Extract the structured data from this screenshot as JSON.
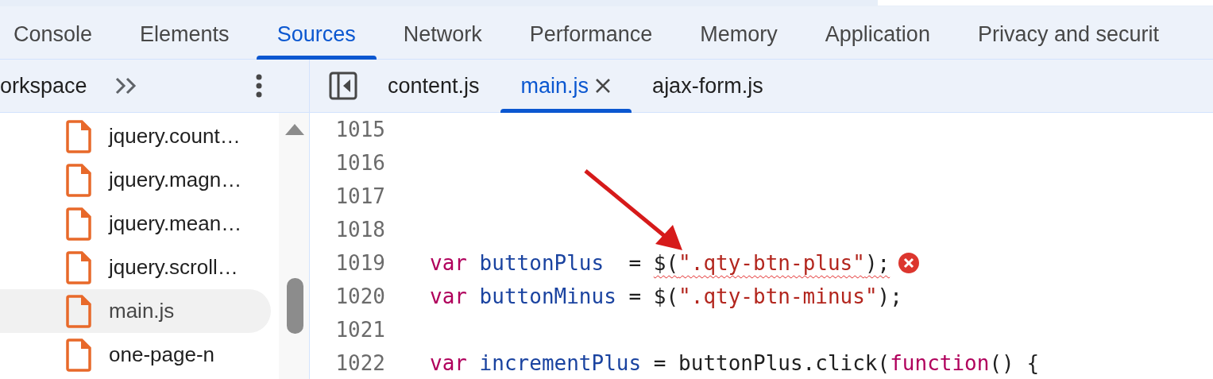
{
  "panel_tabs": [
    {
      "label": "Console",
      "selected": false
    },
    {
      "label": "Elements",
      "selected": false
    },
    {
      "label": "Sources",
      "selected": true
    },
    {
      "label": "Network",
      "selected": false
    },
    {
      "label": "Performance",
      "selected": false
    },
    {
      "label": "Memory",
      "selected": false
    },
    {
      "label": "Application",
      "selected": false
    },
    {
      "label": "Privacy and securit",
      "selected": false
    }
  ],
  "navigator": {
    "tab_label": "orkspace"
  },
  "file_tree": [
    {
      "name": "jquery.count…",
      "selected": false
    },
    {
      "name": "jquery.magn…",
      "selected": false
    },
    {
      "name": "jquery.mean…",
      "selected": false
    },
    {
      "name": "jquery.scroll…",
      "selected": false
    },
    {
      "name": "main.js",
      "selected": true
    },
    {
      "name": "one-page-n",
      "selected": false
    }
  ],
  "editor_tabs": [
    {
      "label": "content.js",
      "selected": false
    },
    {
      "label": "main.js",
      "selected": true,
      "closable": true
    },
    {
      "label": "ajax-form.js",
      "selected": false
    }
  ],
  "code_lines": [
    {
      "number": "1015"
    },
    {
      "number": "1016"
    },
    {
      "number": "1017"
    },
    {
      "number": "1018"
    },
    {
      "number": "1019",
      "error": true,
      "tokens": [
        {
          "kind": "keyword",
          "text": "var"
        },
        {
          "kind": "ident",
          "text": "buttonPlus",
          "space_before": true
        },
        {
          "kind": "plain",
          "text": "  = "
        },
        {
          "kind": "plain",
          "text": "$(",
          "squiggle": true
        },
        {
          "kind": "string",
          "text": "\".qty-btn-plus\"",
          "squiggle": true
        },
        {
          "kind": "plain",
          "text": ");",
          "squiggle": true
        }
      ]
    },
    {
      "number": "1020",
      "tokens": [
        {
          "kind": "keyword",
          "text": "var"
        },
        {
          "kind": "ident",
          "text": "buttonMinus",
          "space_before": true
        },
        {
          "kind": "plain",
          "text": " = $("
        },
        {
          "kind": "string",
          "text": "\".qty-btn-minus\""
        },
        {
          "kind": "plain",
          "text": ");"
        }
      ]
    },
    {
      "number": "1021"
    },
    {
      "number": "1022",
      "tokens": [
        {
          "kind": "keyword",
          "text": "var"
        },
        {
          "kind": "ident",
          "text": "incrementPlus",
          "space_before": true
        },
        {
          "kind": "plain",
          "text": " = buttonPlus.click("
        },
        {
          "kind": "keyword",
          "text": "function"
        },
        {
          "kind": "plain",
          "text": "() {"
        }
      ]
    }
  ],
  "annotation": {
    "kind": "arrow"
  }
}
